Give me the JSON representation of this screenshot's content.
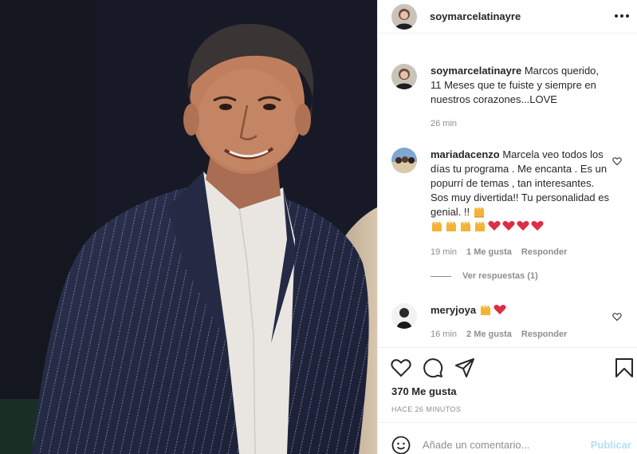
{
  "post": {
    "author": "soymarcelatinayre",
    "caption_user": "soymarcelatinayre",
    "caption_text": "Marcos querido, 11 Meses que te fuiste y siempre en nuestros corazones...LOVE",
    "caption_time": "26 min",
    "likes": "370 Me gusta",
    "posted_ago": "HACE 26 MINUTOS"
  },
  "comments": [
    {
      "user": "mariadacenzo",
      "text": "Marcela veo todos los días tu programa . Me encanta . Es un popurrí de temas , tan interesantes. Sos muy divertida!! Tu personalidad es genial. !!",
      "emojis": [
        "raising-hands",
        "raising-hands",
        "raising-hands",
        "raising-hands",
        "raising-hands",
        "red-heart",
        "red-heart",
        "red-heart",
        "red-heart"
      ],
      "time": "19 min",
      "likes": "1 Me gusta",
      "reply": "Responder",
      "view_replies": "Ver respuestas (1)"
    },
    {
      "user": "meryjoya",
      "emojis": [
        "raising-hands",
        "red-heart"
      ],
      "time": "16 min",
      "likes": "2 Me gusta",
      "reply": "Responder"
    }
  ],
  "add_comment": {
    "placeholder": "Añade un comentario...",
    "post_label": "Publicar"
  },
  "icons": {
    "more": "more-options-icon",
    "like": "heart-icon",
    "comment": "comment-bubble-icon",
    "share": "paper-plane-icon",
    "save": "bookmark-icon",
    "emoji": "smiley-icon"
  },
  "colors": {
    "text": "#262626",
    "muted": "#8e8e8e",
    "border": "#efefef",
    "publish_disabled": "#b2dffc",
    "heart": "#e0245e"
  }
}
